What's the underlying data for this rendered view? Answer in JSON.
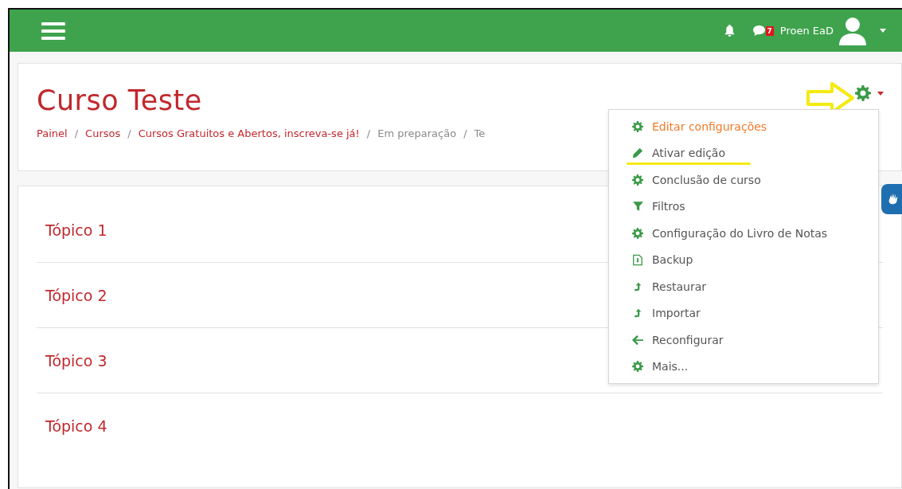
{
  "navbar": {
    "notifications": {
      "badge": "7"
    },
    "user": {
      "name": "Proen EaD"
    }
  },
  "course": {
    "title": "Curso Teste",
    "separator": "/",
    "breadcrumb": [
      {
        "label": "Painel",
        "link": true
      },
      {
        "label": "Cursos",
        "link": true
      },
      {
        "label": "Cursos Gratuitos e Abertos, inscreva-se já!",
        "link": true
      },
      {
        "label": "Em preparação",
        "link": false
      },
      {
        "label": "Te",
        "link": false
      }
    ]
  },
  "settings_menu": {
    "expanded": true,
    "items": [
      {
        "label": "Editar configurações",
        "kind": "gear",
        "selected": true
      },
      {
        "label": "Ativar edição",
        "kind": "pencil",
        "selected": false,
        "underlined": true
      },
      {
        "label": "Conclusão de curso",
        "kind": "gear",
        "selected": false
      },
      {
        "label": "Filtros",
        "kind": "filter",
        "selected": false
      },
      {
        "label": "Configuração do Livro de Notas",
        "kind": "gear",
        "selected": false
      },
      {
        "label": "Backup",
        "kind": "file",
        "selected": false
      },
      {
        "label": "Restaurar",
        "kind": "upload",
        "selected": false
      },
      {
        "label": "Importar",
        "kind": "upload",
        "selected": false
      },
      {
        "label": "Reconfigurar",
        "kind": "back",
        "selected": false
      },
      {
        "label": "Mais...",
        "kind": "gear",
        "selected": false
      }
    ]
  },
  "topics": [
    {
      "title": "Tópico 1"
    },
    {
      "title": "Tópico 2"
    },
    {
      "title": "Tópico 3"
    },
    {
      "title": "Tópico 4"
    }
  ]
}
